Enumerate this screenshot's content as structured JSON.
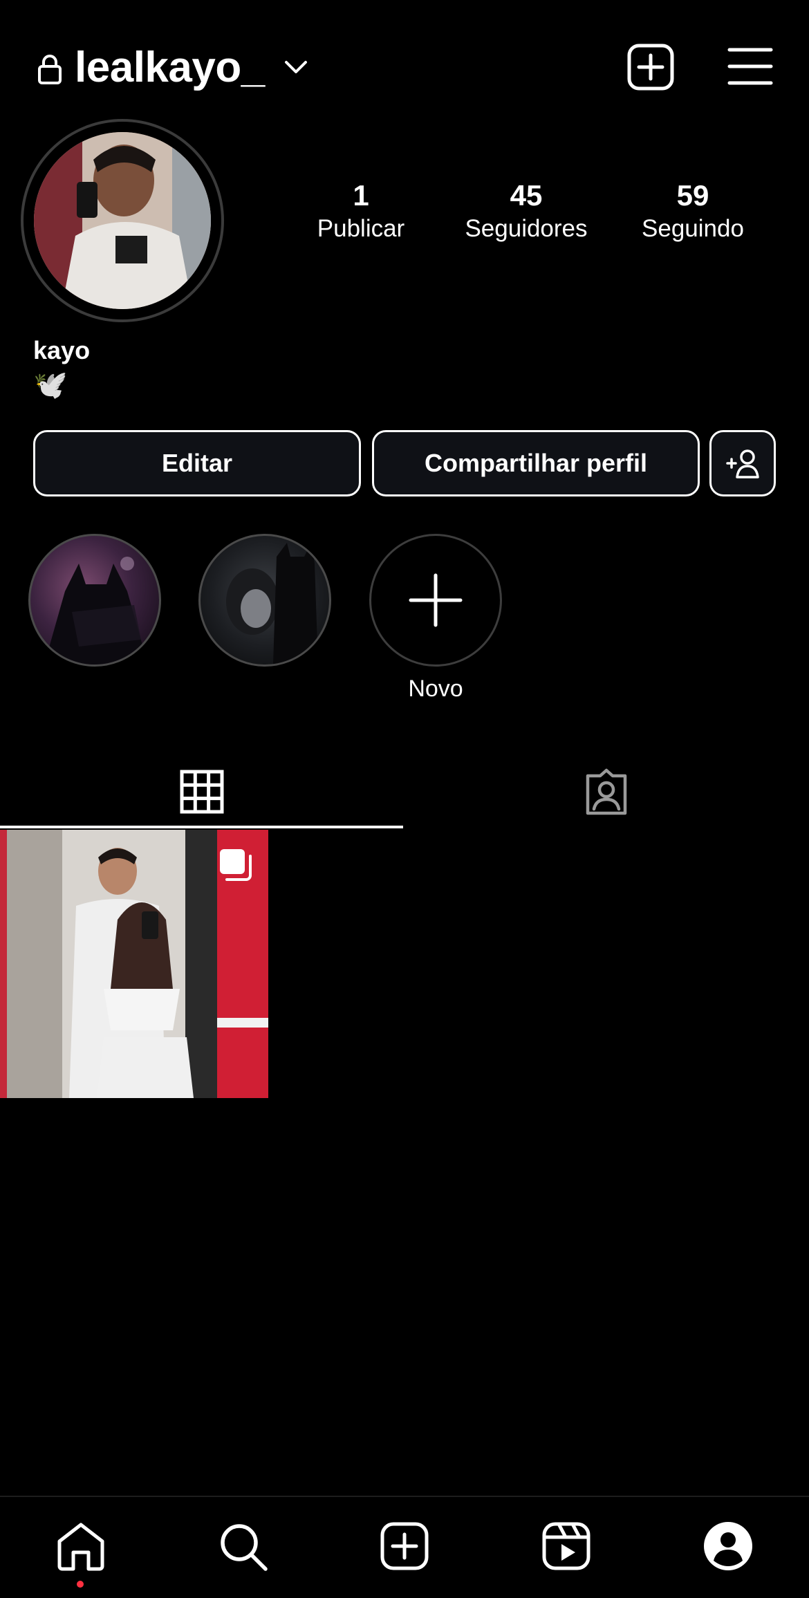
{
  "header": {
    "username": "lealkayo_",
    "lock_icon": "lock-icon",
    "dropdown_icon": "chevron-down-icon",
    "create_icon": "plus-square-icon",
    "menu_icon": "hamburger-menu-icon"
  },
  "profile": {
    "avatar": "profile-photo",
    "display_name": "kayo",
    "bio": "🕊️"
  },
  "stats": [
    {
      "value": "1",
      "label": "Publicar"
    },
    {
      "value": "45",
      "label": "Seguidores"
    },
    {
      "value": "59",
      "label": "Seguindo"
    }
  ],
  "actions": {
    "edit_label": "Editar",
    "share_label": "Compartilhar perfil",
    "discover_icon": "add-person-icon"
  },
  "highlights": {
    "items": [
      {
        "thumbnail": "highlight-batman"
      },
      {
        "thumbnail": "highlight-batman-catwoman"
      }
    ],
    "new_label": "Novo"
  },
  "tabs": [
    {
      "icon": "grid-icon",
      "active": true
    },
    {
      "icon": "tagged-person-icon",
      "active": false
    }
  ],
  "posts": [
    {
      "thumbnail": "couple-mirror-selfie",
      "multi": true
    }
  ],
  "bottom_nav": [
    {
      "icon": "home-icon",
      "notification": true
    },
    {
      "icon": "search-icon"
    },
    {
      "icon": "create-icon"
    },
    {
      "icon": "reels-icon"
    },
    {
      "icon": "profile-icon",
      "active": true
    }
  ],
  "colors": {
    "background": "#000000",
    "button_bg": "#0f1116",
    "notification_dot": "#ff3040"
  }
}
